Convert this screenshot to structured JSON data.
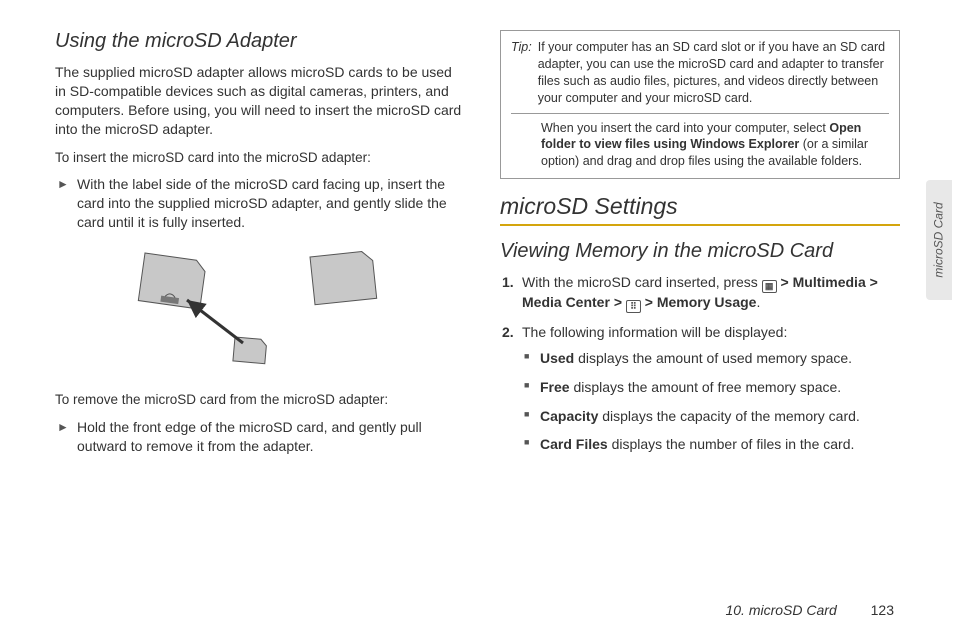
{
  "left": {
    "heading": "Using the microSD Adapter",
    "intro": "The supplied microSD adapter allows microSD cards to be used in SD-compatible devices such as digital cameras, printers, and computers. Before using, you will need to insert the microSD card into the microSD adapter.",
    "insert_label": "To insert the microSD card into the microSD adapter:",
    "insert_step": "With the label side of the microSD card facing up, insert the card into the supplied microSD adapter, and gently slide the card until it is fully inserted.",
    "remove_label": "To remove the microSD card from the microSD adapter:",
    "remove_step": "Hold the front edge of the microSD card, and gently pull outward to remove it from the adapter."
  },
  "tip": {
    "label": "Tip:",
    "body1": "If your computer has an SD card slot or if you have an SD card adapter, you can use the microSD card and adapter to transfer files such as audio files, pictures, and videos directly between your computer and your microSD card.",
    "body2_pre": "When you insert the card into your computer, select ",
    "body2_bold": "Open folder to view files using Windows Explorer",
    "body2_post": " (or a similar option) and drag and drop files using the available folders."
  },
  "right": {
    "section_heading": "microSD Settings",
    "sub_heading": "Viewing Memory in the microSD Card",
    "step1_pre": "With the microSD card inserted, press ",
    "nav": {
      "multimedia": "Multimedia",
      "media_center": "Media Center",
      "memory_usage": "Memory Usage"
    },
    "step2": "The following information will be displayed:",
    "items": {
      "used_label": "Used",
      "used_text": " displays the amount of used memory space.",
      "free_label": "Free",
      "free_text": " displays the amount of free memory space.",
      "capacity_label": "Capacity",
      "capacity_text": " displays the capacity of the memory card.",
      "cardfiles_label": "Card Files",
      "cardfiles_text": " displays the number of files in the card."
    }
  },
  "footer": {
    "chapter": "10. microSD Card",
    "page": "123"
  },
  "sidetab": "microSD Card",
  "gt": ">"
}
